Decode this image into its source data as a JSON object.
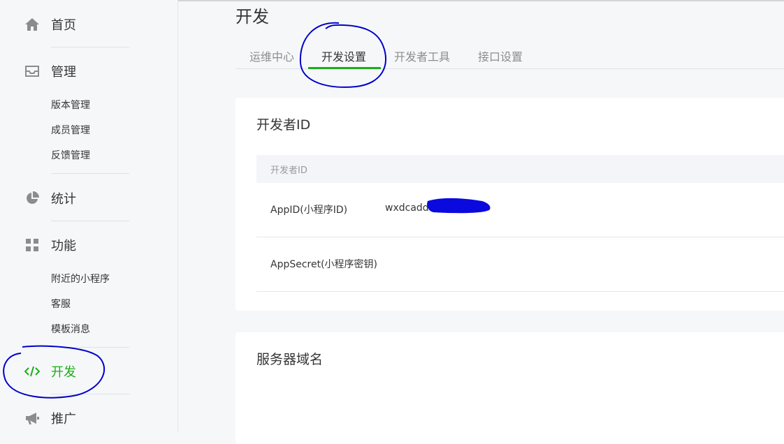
{
  "sidebar": {
    "home": {
      "label": "首页",
      "icon": "home-icon"
    },
    "manage": {
      "label": "管理",
      "icon": "inbox-icon",
      "items": [
        "版本管理",
        "成员管理",
        "反馈管理"
      ]
    },
    "stats": {
      "label": "统计",
      "icon": "pie-chart-icon"
    },
    "features": {
      "label": "功能",
      "icon": "grid-icon",
      "items": [
        "附近的小程序",
        "客服",
        "模板消息"
      ]
    },
    "dev": {
      "label": "开发",
      "icon": "code-icon",
      "active": true
    },
    "promote": {
      "label": "推广",
      "icon": "megaphone-icon"
    }
  },
  "page": {
    "title": "开发"
  },
  "tabs": [
    {
      "label": "运维中心",
      "active": false
    },
    {
      "label": "开发设置",
      "active": true
    },
    {
      "label": "开发者工具",
      "active": false
    },
    {
      "label": "接口设置",
      "active": false
    }
  ],
  "developer_id_card": {
    "title": "开发者ID",
    "table_header": "开发者ID",
    "rows": [
      {
        "key": "AppID(小程序ID)",
        "value": "wxdcadd"
      },
      {
        "key": "AppSecret(小程序密钥)",
        "value": ""
      }
    ]
  },
  "server_domain_card": {
    "title": "服务器域名"
  },
  "colors": {
    "accent": "#1aad19",
    "annotation": "#0000cc",
    "redaction": "#0a0adf"
  }
}
